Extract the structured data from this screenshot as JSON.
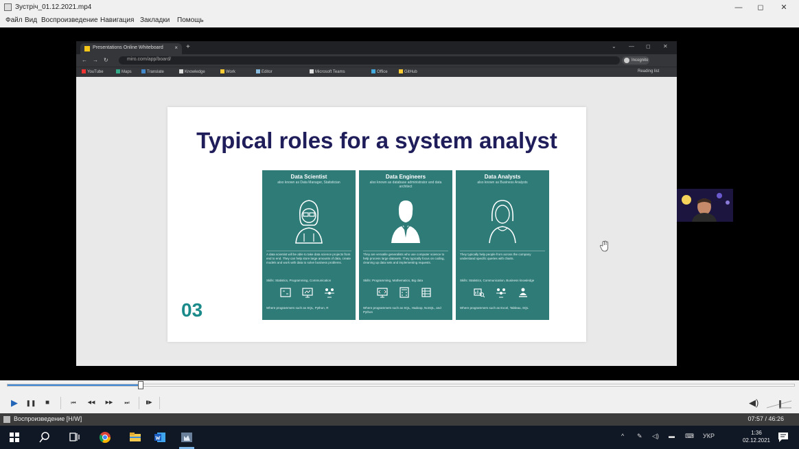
{
  "window": {
    "title": "Зустріч_01.12.2021.mp4",
    "controls": {
      "minimize": "—",
      "maximize": "◻",
      "close": "✕"
    }
  },
  "menu": [
    "Файл",
    "Вид",
    "Воспроизведение",
    "Навигация",
    "Закладки",
    "Помощь"
  ],
  "browser": {
    "tab_title": "Presentations Online Whiteboard",
    "tab_close": "×",
    "new_tab": "+",
    "url": "miro.com/app/board/",
    "profile_label": "Incognito",
    "bookmarks": [
      "YouTube",
      "Maps",
      "Translate",
      "Knowledge",
      "Work",
      "Editor",
      "Microsoft Teams",
      "Office",
      "GitHub"
    ],
    "reading_list": "Reading list"
  },
  "slide": {
    "title": "Typical roles for a system analyst",
    "number": "03",
    "cards": [
      {
        "title": "Data Scientist",
        "subtitle": "also known as Data Manager, Statistician",
        "description": "A data scientist will be able to take data science projects from end to end. They can help store large amounts of data, create models and work with data to solve business problems.",
        "skills": "Skills: Statistics, Programming, Communication",
        "footer": "Where programmers such as SQL, Python, R"
      },
      {
        "title": "Data Engineers",
        "subtitle": "also known as database administrator and data architect",
        "description": "They are versatile generalists who use computer science to help process large datasets. They typically focus on coding, cleaning up data sets and implementing requests.",
        "skills": "Skills: Programming, Mathematics, Big data",
        "footer": "Where programmers such as SQL, Hadoop, NoSQL, and Python"
      },
      {
        "title": "Data Analysts",
        "subtitle": "also known as Business Analysts",
        "description": "They typically help people from across the company understand specific queries with charts.",
        "skills": "Skills: Statistics, Communication, Business knowledge",
        "footer": "Where programmers such as Excel, Tableau, SQL"
      }
    ]
  },
  "player": {
    "progress_fraction": 0.17,
    "buttons": {
      "play": "▶",
      "pause": "❚❚",
      "stop": "■",
      "prev": "⏮",
      "rewind": "◀◀",
      "forward": "▶▶",
      "next": "⏭",
      "frame": "▮▶"
    },
    "volume_icon": "speaker-icon",
    "status_text": "Воспроизведение [H/W]",
    "time": "07:57 / 46:26"
  },
  "taskbar": {
    "tray_language": "УКР",
    "clock_time": "1:36",
    "clock_date": "02.12.2021"
  },
  "colors": {
    "card_teal": "#2e7b78",
    "title_navy": "#1f1d5a",
    "number_teal": "#1a8a8a",
    "taskbar": "#101725"
  }
}
